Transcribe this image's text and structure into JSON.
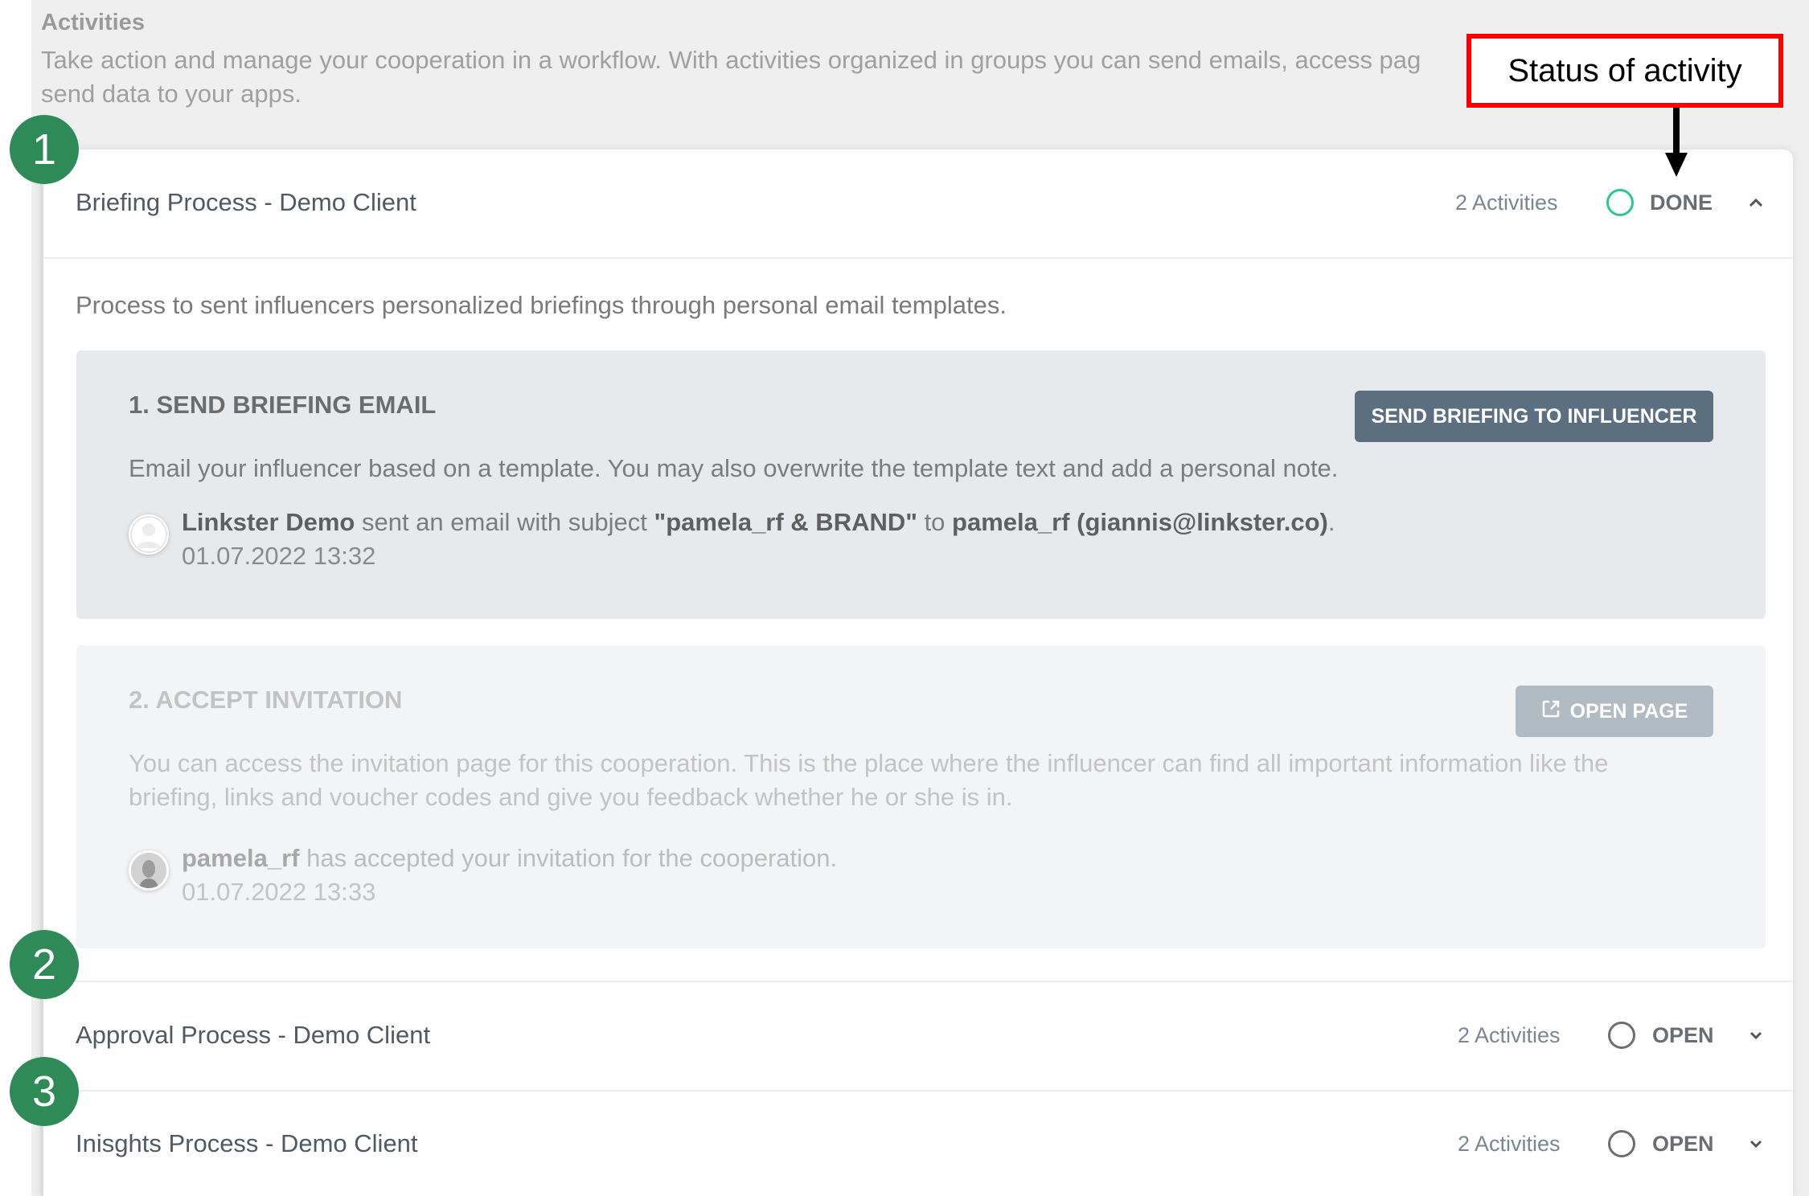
{
  "page": {
    "title": "Activities",
    "description": "Take action and manage your cooperation in a workflow. With activities organized in groups you can send emails, access pag send data to your apps.",
    "description_line1": "Take action and manage your cooperation in a workflow. With activities organized in groups you can send emails, access pag",
    "description_line2": "send data to your apps."
  },
  "annotation": {
    "label": "Status of activity",
    "border_color": "#ff0000"
  },
  "badges": [
    "1",
    "2",
    "3"
  ],
  "colors": {
    "badge": "#2e8b57",
    "status_done": "#2ec98a",
    "primary_button": "#5c6f80",
    "disabled_button": "#b0bbc4"
  },
  "groups": [
    {
      "title": "Briefing Process - Demo Client",
      "count": "2 Activities",
      "status": "DONE",
      "expanded": true,
      "description": "Process to sent influencers personalized briefings through personal email templates.",
      "activities": [
        {
          "title": "1. SEND BRIEFING EMAIL",
          "button": "SEND BRIEFING TO INFLUENCER",
          "text": "Email your influencer based on a template. You may also overwrite the template text and add a personal note.",
          "log": {
            "actor": "Linkster Demo",
            "action": " sent an email with subject ",
            "subject": "\"pamela_rf & BRAND\"",
            "to_word": " to ",
            "recipient": "pamela_rf (giannis@linkster.co)",
            "end": ".",
            "time": "01.07.2022 13:32"
          }
        },
        {
          "title": "2. ACCEPT INVITATION",
          "button": "OPEN PAGE",
          "button_icon": "external-link-icon",
          "text": "You can access the invitation page for this cooperation. This is the place where the influencer can find all important information like the briefing, links and voucher codes and give you feedback whether he or she is in.",
          "log": {
            "actor": "pamela_rf",
            "action": " has accepted your invitation for the cooperation.",
            "time": "01.07.2022 13:33"
          }
        }
      ]
    },
    {
      "title": "Approval Process - Demo Client",
      "count": "2 Activities",
      "status": "OPEN",
      "expanded": false
    },
    {
      "title": "Inisghts Process - Demo Client",
      "count": "2 Activities",
      "status": "OPEN",
      "expanded": false
    }
  ]
}
